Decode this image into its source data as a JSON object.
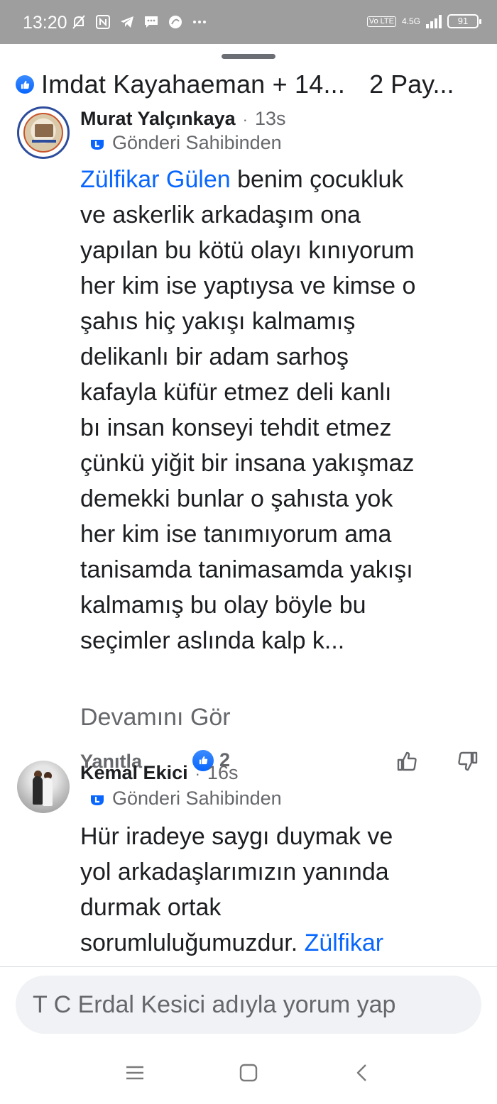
{
  "status_bar": {
    "time": "13:20",
    "network": "4.5G",
    "lte_label": "Vo LTE",
    "battery": "91"
  },
  "header": {
    "reactors": "Imdat Kayahaeman + 14...",
    "shares": "2 Pay..."
  },
  "comments": [
    {
      "author": "Murat Yalçınkaya",
      "time": "13s",
      "badge": "Gönderi Sahibinden",
      "mention": "Zülfikar Gülen",
      "text": " benim çocukluk\nve askerlik arkadaşım ona\nyapılan bu kötü olayı kınıyorum\nher kim ise yaptıysa ve kimse o\nşahıs hiç yakışı kalmamış\ndelikanlı bir adam sarhoş\nkafayla küfür etmez deli kanlı\nbı insan konseyi tehdit etmez\nçünkü yiğit bir insana yakışmaz\ndemekki bunlar o şahısta yok\nher kim ise tanımıyorum ama\ntanisamda tanimasamda yakışı\nkalmamış bu olay böyle bu\nseçimler aslında kalp k...",
      "see_more": "Devamını Gör",
      "reply_label": "Yanıtla",
      "reaction_count": "2"
    },
    {
      "author": "Kemal Ekici",
      "time": "16s",
      "badge": "Gönderi Sahibinden",
      "text": "Hür iradeye saygı duymak ve\nyol arkadaşlarımızın yanında\ndurmak ortak\nsorumluluğumuzdur. ",
      "mention": "Zülfikar"
    }
  ],
  "composer": {
    "placeholder": "T C Erdal Kesici adıyla yorum yap"
  },
  "colors": {
    "accent": "#0866ff",
    "secondary_text": "#65676b",
    "status_bar": "#9e9e9e"
  }
}
